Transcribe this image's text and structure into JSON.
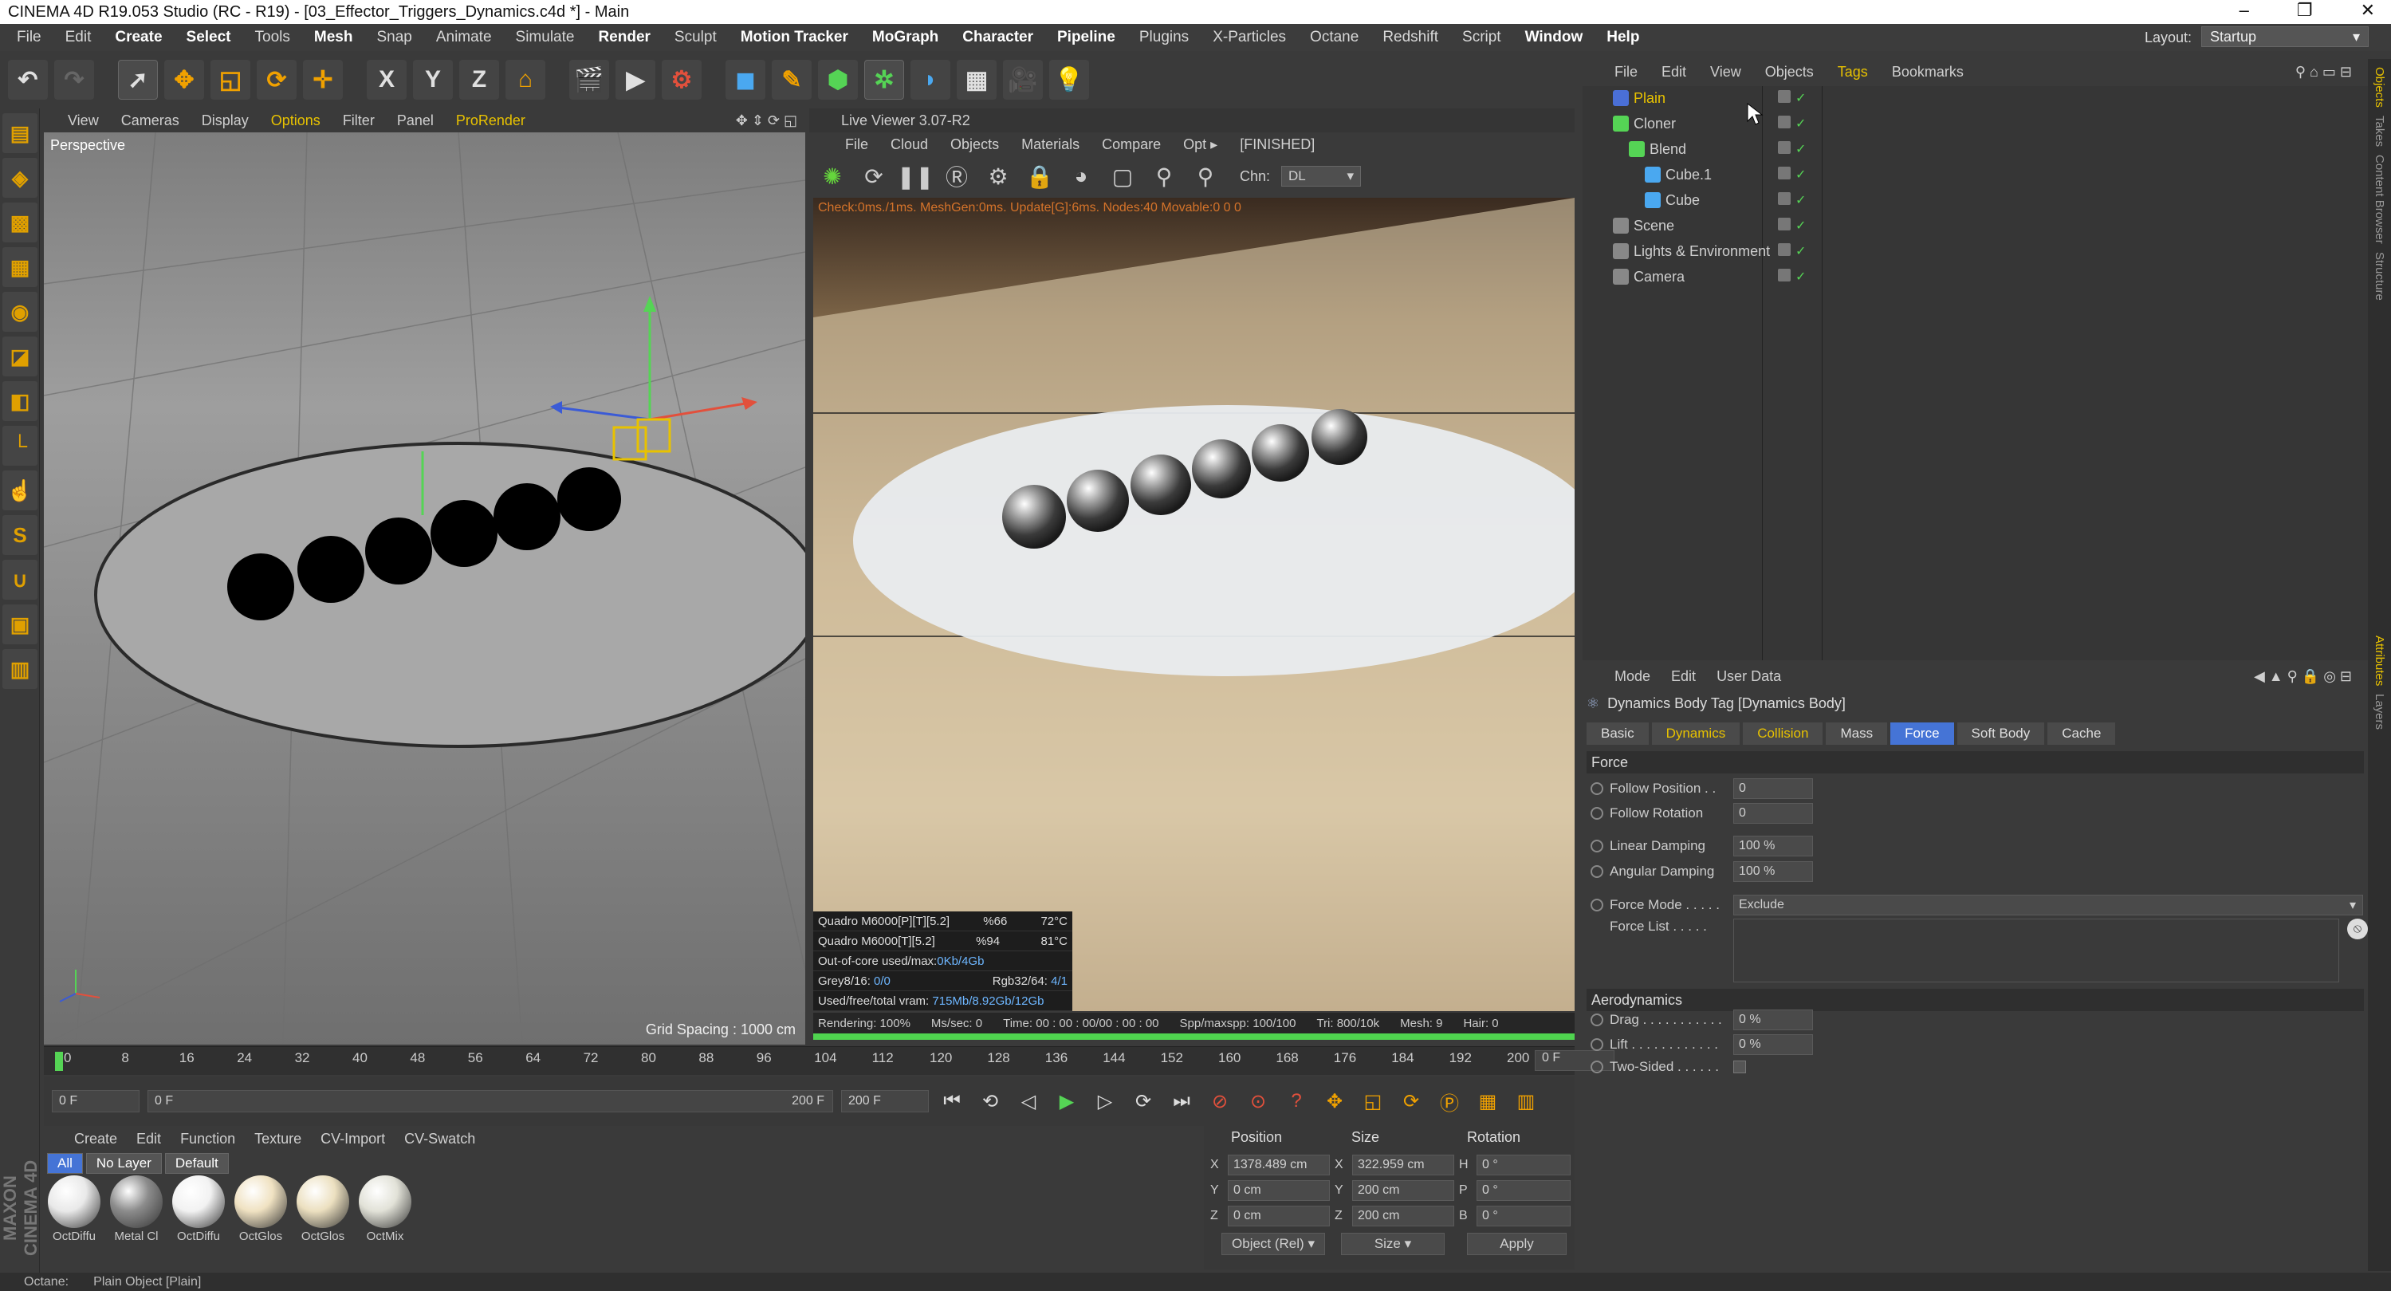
{
  "window": {
    "title": "CINEMA 4D R19.053 Studio (RC - R19) - [03_Effector_Triggers_Dynamics.c4d *] - Main"
  },
  "menubar": {
    "items": [
      "File",
      "Edit",
      "Create",
      "Select",
      "Tools",
      "Mesh",
      "Snap",
      "Animate",
      "Simulate",
      "Render",
      "Sculpt",
      "Motion Tracker",
      "MoGraph",
      "Character",
      "Pipeline",
      "Plugins",
      "X-Particles",
      "Octane",
      "Redshift",
      "Script",
      "Window",
      "Help"
    ],
    "layout_label": "Layout:",
    "layout_value": "Startup"
  },
  "toolbar": {
    "axis_x": "X",
    "axis_y": "Y",
    "axis_z": "Z"
  },
  "viewport": {
    "menu": [
      "View",
      "Cameras",
      "Display",
      "Options",
      "Filter",
      "Panel",
      "ProRender"
    ],
    "label": "Perspective",
    "grid_spacing": "Grid Spacing : 1000 cm"
  },
  "live_viewer": {
    "title": "Live Viewer 3.07-R2",
    "menu": [
      "File",
      "Cloud",
      "Objects",
      "Materials",
      "Compare",
      "Opt ▸",
      "[FINISHED]"
    ],
    "chn_label": "Chn:",
    "chn_value": "DL",
    "stats_top": "Check:0ms./1ms. MeshGen:0ms. Update[G]:6ms. Nodes:40 Movable:0 0 0",
    "gpu": [
      {
        "name": "Quadro M6000[P][T][5.2]",
        "pct": "%66",
        "temp": "72°C"
      },
      {
        "name": "Quadro M6000[T][5.2]",
        "pct": "%94",
        "temp": "81°C"
      }
    ],
    "ooc_label": "Out-of-core used/max:",
    "ooc_value": "0Kb/4Gb",
    "grey_label": "Grey8/16:",
    "grey_value": "0/0",
    "rgb_label": "Rgb32/64:",
    "rgb_value": "4/1",
    "vram_label": "Used/free/total vram:",
    "vram_value": "715Mb/8.92Gb/12Gb",
    "status": {
      "rendering": "Rendering: 100%",
      "ms": "Ms/sec: 0",
      "time": "Time: 00 : 00 : 00/00 : 00 : 00",
      "spp": "Spp/maxspp: 100/100",
      "tri": "Tri: 800/10k",
      "mesh": "Mesh: 9",
      "hair": "Hair: 0"
    },
    "progress": 1.0
  },
  "timeline": {
    "ticks": [
      "0",
      "8",
      "16",
      "24",
      "32",
      "40",
      "48",
      "56",
      "64",
      "72",
      "80",
      "88",
      "96",
      "104",
      "112",
      "120",
      "128",
      "136",
      "144",
      "152",
      "160",
      "168",
      "176",
      "184",
      "192",
      "200"
    ],
    "current_frame": "0 F"
  },
  "transport": {
    "start": "0 F",
    "range_start": "0 F",
    "range_end": "200 F",
    "end": "200 F"
  },
  "materials": {
    "menu": [
      "Create",
      "Edit",
      "Function",
      "Texture",
      "CV-Import",
      "CV-Swatch"
    ],
    "filters": [
      "All",
      "No Layer",
      "Default"
    ],
    "items": [
      {
        "label": "OctDiffu",
        "color": "#e9e9e9"
      },
      {
        "label": "Metal Cl",
        "color": "#8c8c8c"
      },
      {
        "label": "OctDiffu",
        "color": "#f2f2f2"
      },
      {
        "label": "OctGlos",
        "color": "#f0e2c2"
      },
      {
        "label": "OctGlos",
        "color": "#ece0c0"
      },
      {
        "label": "OctMix",
        "color": "#e2e2d8"
      }
    ]
  },
  "coords": {
    "head_position": "Position",
    "head_size": "Size",
    "head_rotation": "Rotation",
    "rows": [
      {
        "axis": "X",
        "pos": "1378.489 cm",
        "size_axis": "X",
        "size": "322.959 cm",
        "rot_axis": "H",
        "rot": "0 °"
      },
      {
        "axis": "Y",
        "pos": "0 cm",
        "size_axis": "Y",
        "size": "200 cm",
        "rot_axis": "P",
        "rot": "0 °"
      },
      {
        "axis": "Z",
        "pos": "0 cm",
        "size_axis": "Z",
        "size": "200 cm",
        "rot_axis": "B",
        "rot": "0 °"
      }
    ],
    "mode_select": "Object (Rel)",
    "size_select": "Size",
    "apply": "Apply"
  },
  "statusbar": {
    "text": "Octane:       Plain Object [Plain]"
  },
  "object_manager": {
    "menu": [
      "File",
      "Edit",
      "View",
      "Objects",
      "Tags",
      "Bookmarks"
    ],
    "objects": [
      {
        "name": "Plain",
        "indent": 0,
        "color": "#e8c200"
      },
      {
        "name": "Cloner",
        "indent": 0,
        "color": "#cfcfcf"
      },
      {
        "name": "Blend",
        "indent": 1,
        "color": "#cfcfcf"
      },
      {
        "name": "Cube.1",
        "indent": 2,
        "color": "#cfcfcf"
      },
      {
        "name": "Cube",
        "indent": 2,
        "color": "#cfcfcf"
      },
      {
        "name": "Scene",
        "indent": 0,
        "color": "#cfcfcf"
      },
      {
        "name": "Lights & Environment",
        "indent": 0,
        "color": "#cfcfcf"
      },
      {
        "name": "Camera",
        "indent": 0,
        "color": "#cfcfcf"
      }
    ]
  },
  "right_tabs": [
    "Objects",
    "Takes",
    "Content Browser",
    "Structure",
    "Attributes",
    "Layers"
  ],
  "attributes": {
    "menu": [
      "Mode",
      "Edit",
      "User Data"
    ],
    "title": "Dynamics Body Tag [Dynamics Body]",
    "tabs": [
      "Basic",
      "Dynamics",
      "Collision",
      "Mass",
      "Force",
      "Soft Body",
      "Cache"
    ],
    "section_force": "Force",
    "follow_position_label": "Follow Position . .",
    "follow_position": "0",
    "follow_rotation_label": "Follow Rotation",
    "follow_rotation": "0",
    "linear_damping_label": "Linear Damping",
    "linear_damping": "100 %",
    "angular_damping_label": "Angular Damping",
    "angular_damping": "100 %",
    "force_mode_label": "Force Mode . . . . .",
    "force_mode": "Exclude",
    "force_list_label": "Force List . . . . .",
    "section_aero": "Aerodynamics",
    "drag_label": "Drag . . . . . . . . . . .",
    "drag": "0 %",
    "lift_label": "Lift . . . . . . . . . . . .",
    "lift": "0 %",
    "two_sided_label": "Two-Sided . . . . . ."
  }
}
